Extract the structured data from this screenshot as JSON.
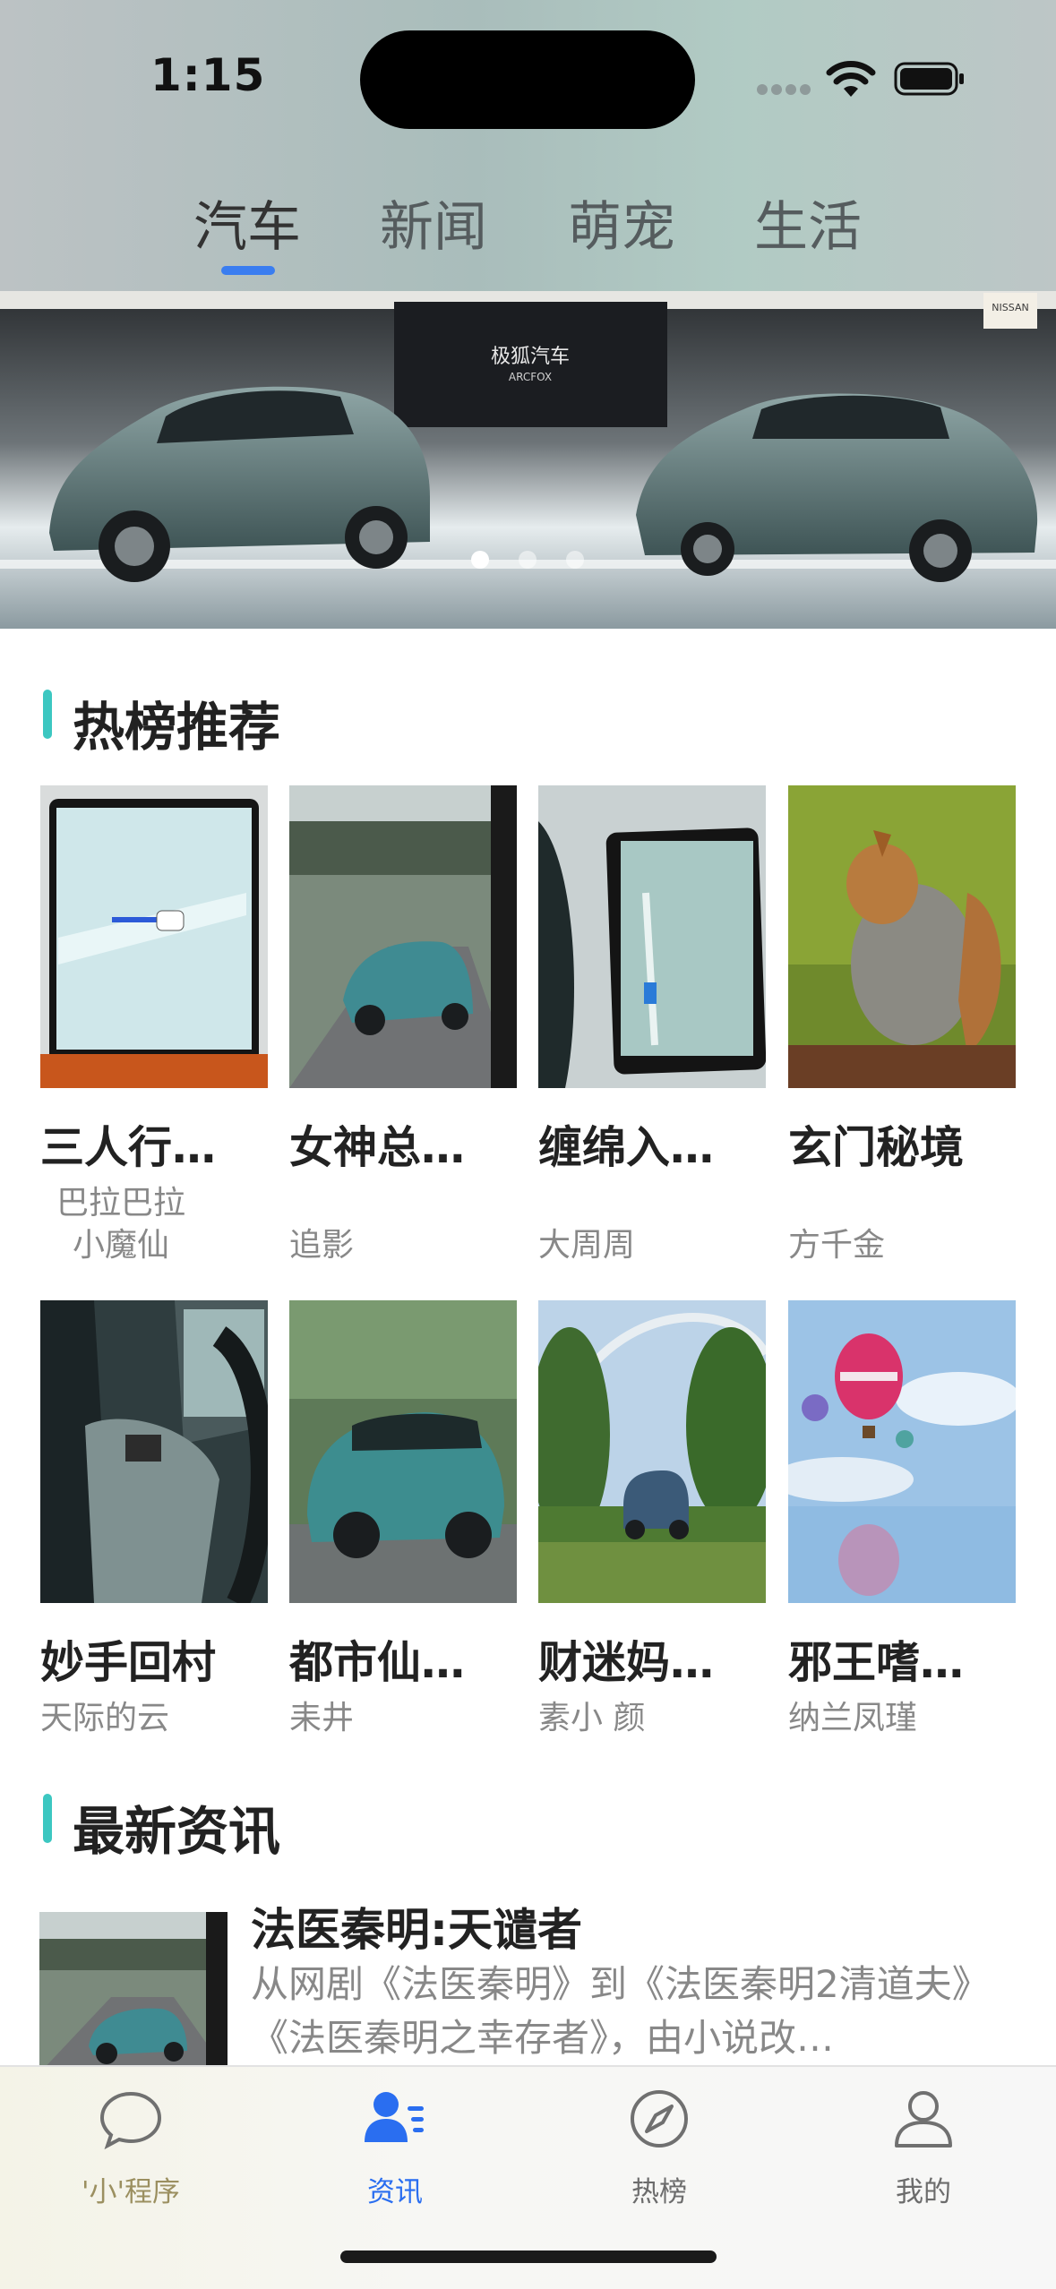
{
  "status_bar": {
    "time": "1:15"
  },
  "top_tabs": [
    {
      "label": "汽车",
      "active": true
    },
    {
      "label": "新闻",
      "active": false
    },
    {
      "label": "萌宠",
      "active": false
    },
    {
      "label": "生活",
      "active": false
    }
  ],
  "banner": {
    "brand_text": "极狐汽车",
    "brand_sub": "ARCFOX",
    "dealer_sign": "NISSAN",
    "page_indicator": {
      "count": 3,
      "current": 1
    }
  },
  "hot_section": {
    "title": "热榜推荐",
    "items": [
      {
        "title": "三人行…",
        "author_line1": "巴拉巴拉",
        "author_line2": "小魔仙"
      },
      {
        "title": "女神总…",
        "author": "追影"
      },
      {
        "title": "缠绵入…",
        "author": "大周周"
      },
      {
        "title": "玄门秘境",
        "author": "方千金"
      },
      {
        "title": "妙手回村",
        "author": "天际的云"
      },
      {
        "title": "都市仙…",
        "author": "耒井"
      },
      {
        "title": "财迷妈…",
        "author": "素小 颜"
      },
      {
        "title": "邪王嗜…",
        "author": "纳兰凤瑾"
      }
    ]
  },
  "news_section": {
    "title": "最新资讯",
    "items": [
      {
        "title": "法医秦明:天谴者",
        "desc": "从网剧《法医秦明》到《法医秦明2清道夫》《法医秦明之幸存者》，由小说改…"
      }
    ]
  },
  "tabbar": [
    {
      "label": "'小'程序",
      "icon": "chat-bubble-icon",
      "active": false
    },
    {
      "label": "资讯",
      "icon": "user-list-icon",
      "active": true
    },
    {
      "label": "热榜",
      "icon": "compass-icon",
      "active": false
    },
    {
      "label": "我的",
      "icon": "person-icon",
      "active": false
    }
  ],
  "colors": {
    "accent": "#2a6ef0",
    "section_bar": "#3cc7c1",
    "tab_indicator": "#3a7df0"
  }
}
